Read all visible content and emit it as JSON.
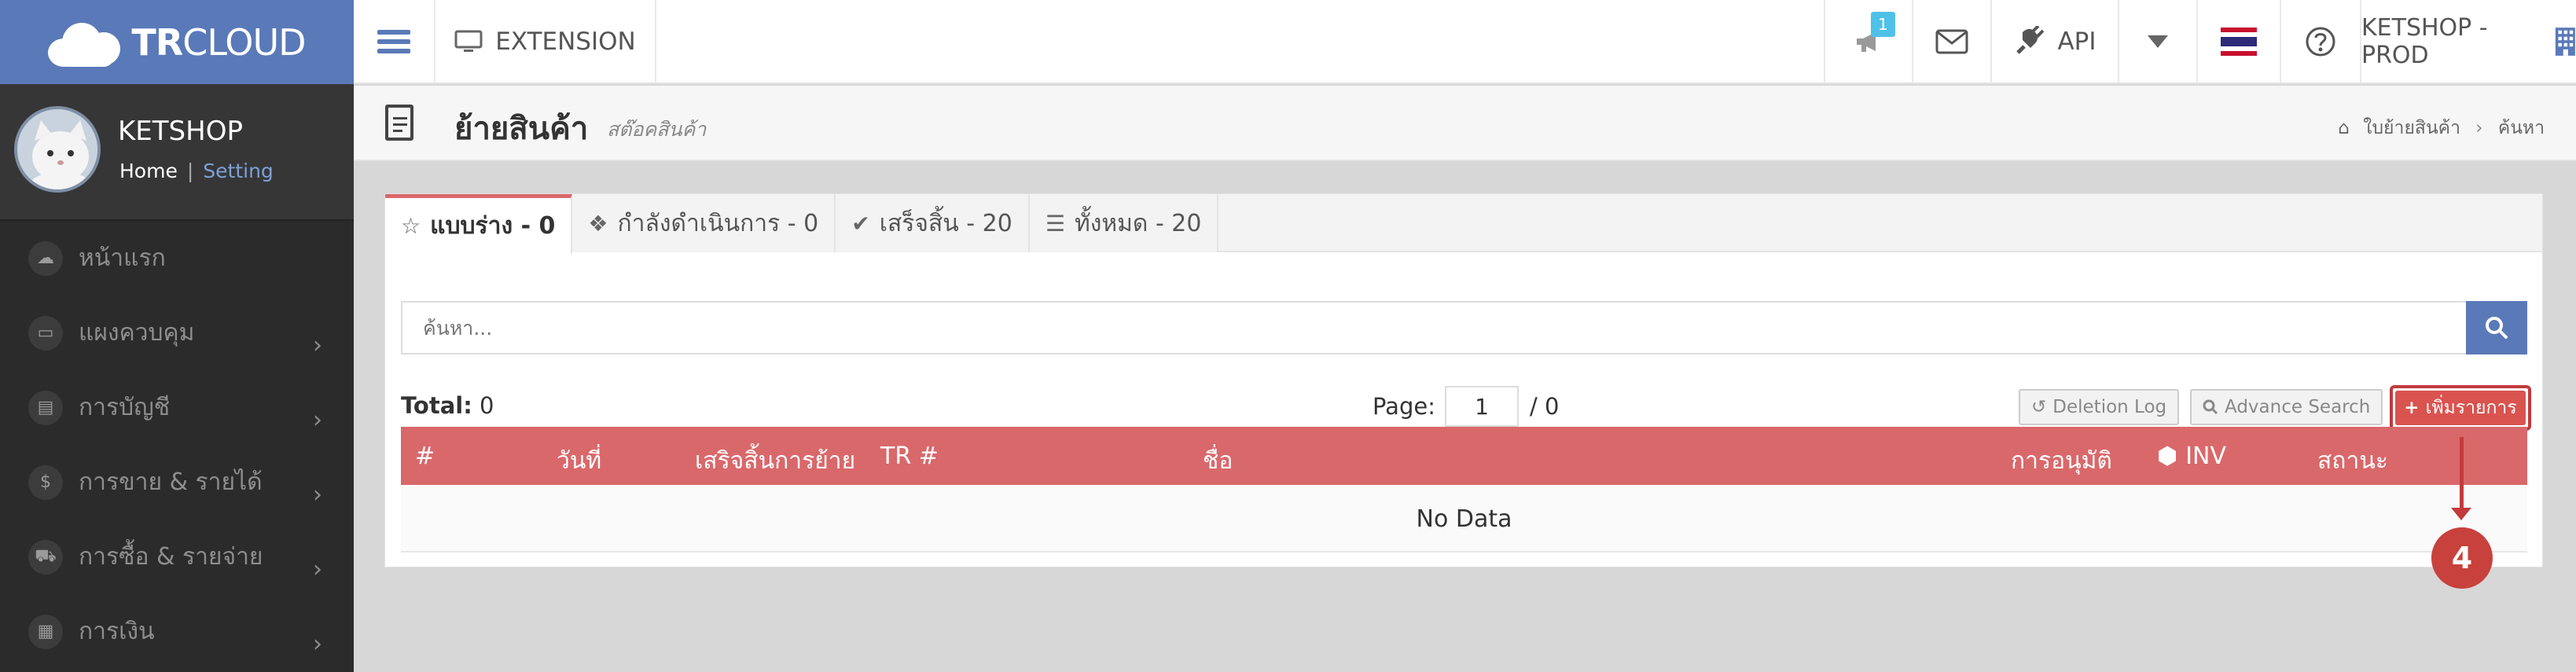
{
  "header": {
    "logo_bold": "TR",
    "logo_rest": "CLOUD",
    "extension_label": "EXTENSION",
    "notification_count": "1",
    "api_label": "API",
    "shop_label": "KETSHOP - PROD"
  },
  "sidebar": {
    "shop_name": "KETSHOP",
    "home_link": "Home",
    "separator": "|",
    "setting_link": "Setting",
    "items": [
      {
        "label": "หน้าแรก",
        "icon": "cloud-icon",
        "chevron": ""
      },
      {
        "label": "แผงควบคุม",
        "icon": "monitor-icon",
        "chevron": "›"
      },
      {
        "label": "การบัญชี",
        "icon": "book-icon",
        "chevron": "›"
      },
      {
        "label": "การขาย & รายได้",
        "icon": "dollar-icon",
        "chevron": "›"
      },
      {
        "label": "การซื้อ & รายจ่าย",
        "icon": "cart-icon",
        "chevron": "›"
      },
      {
        "label": "การเงิน",
        "icon": "calendar-icon",
        "chevron": "›"
      }
    ]
  },
  "page": {
    "title": "ย้ายสินค้า",
    "subtitle": "สต๊อคสินค้า",
    "breadcrumb": [
      "ใบย้ายสินค้า",
      "ค้นหา"
    ],
    "breadcrumb_sep": "›"
  },
  "tabs": [
    {
      "label": "แบบร่าง - 0",
      "icon": "star-icon",
      "glyph": "☆"
    },
    {
      "label": "กำลังดำเนินการ - 0",
      "icon": "dropbox-icon",
      "glyph": "❖"
    },
    {
      "label": "เสร็จสิ้น - 20",
      "icon": "check-circle-icon",
      "glyph": "✔"
    },
    {
      "label": "ทั้งหมด - 20",
      "icon": "list-icon",
      "glyph": "☰"
    }
  ],
  "search": {
    "placeholder": "ค้นหา..."
  },
  "summary": {
    "total_label": "Total:",
    "total_value": "0"
  },
  "pagination": {
    "label": "Page:",
    "current": "1",
    "of": "/ 0"
  },
  "actions": {
    "deletion_log": "Deletion Log",
    "advance_search": "Advance Search",
    "add_item": "เพิ่มรายการ"
  },
  "table": {
    "headers": [
      "#",
      "วันที่",
      "เสริจสิ้นการย้าย",
      "TR #",
      "ชื่อ",
      "การอนุมัติ",
      "INV",
      "สถานะ"
    ],
    "empty_message": "No Data"
  },
  "annotation": {
    "step": "4"
  },
  "colors": {
    "brand_blue": "#5a79b8",
    "table_header": "#d9686b",
    "sidebar_bg": "#2b2b2b",
    "annotation_red": "#c23a3d"
  }
}
